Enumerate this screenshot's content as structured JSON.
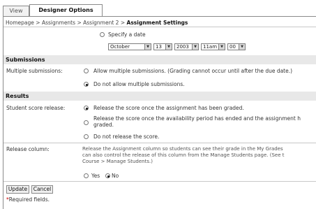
{
  "tabs": {
    "view": "View",
    "designer": "Designer Options"
  },
  "breadcrumb": {
    "home": "Homepage",
    "assignments": "Assignments",
    "assignment": "Assignment 2",
    "current": "Assignment Settings",
    "sep": ">"
  },
  "date": {
    "specify_label": "Specify a date",
    "month": "October",
    "day": "13",
    "year": "2003",
    "hour": "11am",
    "minute": "00"
  },
  "submissions": {
    "heading": "Submissions",
    "label": "Multiple submissions:",
    "allow": "Allow multiple submissions. (Grading cannot occur until after the due date.)",
    "disallow": "Do not allow multiple submissions.",
    "selected": "disallow"
  },
  "results": {
    "heading": "Results",
    "label": "Student score release:",
    "opt1": "Release the score once the assignment has been graded.",
    "opt2_line1": "Release the score once the availability period has ended and the assignment h",
    "opt2_line2": "graded.",
    "opt3": "Do not release the score.",
    "selected": "opt1"
  },
  "release_column": {
    "label": "Release column:",
    "desc_line1": "Release the Assignment column so students can see their grade in the My Grades",
    "desc_line2": "can also control the release of this column from the Manage Students page. (See t",
    "desc_line3": "Course > Manage Students.)",
    "yes": "Yes",
    "no": "No",
    "selected": "no"
  },
  "buttons": {
    "update": "Update",
    "cancel": "Cancel"
  },
  "required": {
    "mark": "*",
    "text": "Required fields."
  }
}
